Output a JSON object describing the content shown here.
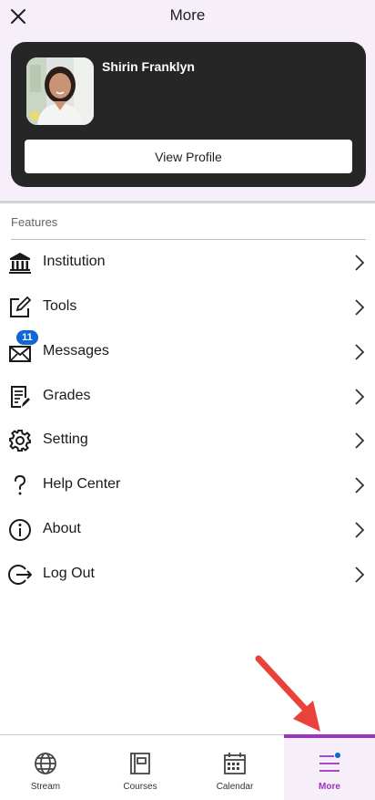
{
  "header": {
    "title": "More",
    "close_icon": "close-icon"
  },
  "profile": {
    "name": "Shirin Franklyn",
    "view_profile_label": "View Profile",
    "avatar": "avatar-photo"
  },
  "features": {
    "section_label": "Features",
    "items": [
      {
        "label": "Institution",
        "icon": "institution-icon"
      },
      {
        "label": "Tools",
        "icon": "tools-edit-icon"
      },
      {
        "label": "Messages",
        "icon": "messages-envelope-icon",
        "badge": "11"
      },
      {
        "label": "Grades",
        "icon": "grades-document-icon"
      },
      {
        "label": "Setting",
        "icon": "gear-icon"
      },
      {
        "label": "Help Center",
        "icon": "question-icon"
      },
      {
        "label": "About",
        "icon": "info-icon"
      },
      {
        "label": "Log Out",
        "icon": "logout-icon"
      }
    ]
  },
  "bottom_nav": {
    "tabs": [
      {
        "label": "Stream",
        "icon": "globe-icon",
        "active": false
      },
      {
        "label": "Courses",
        "icon": "courses-icon",
        "active": false
      },
      {
        "label": "Calendar",
        "icon": "calendar-icon",
        "active": false
      },
      {
        "label": "More",
        "icon": "menu-icon",
        "active": true
      }
    ]
  },
  "colors": {
    "accent": "#9b34bf",
    "header_bg": "#f6eef8",
    "card_bg": "#262626",
    "badge": "#1166d6",
    "annotation_arrow": "#e8423a"
  }
}
